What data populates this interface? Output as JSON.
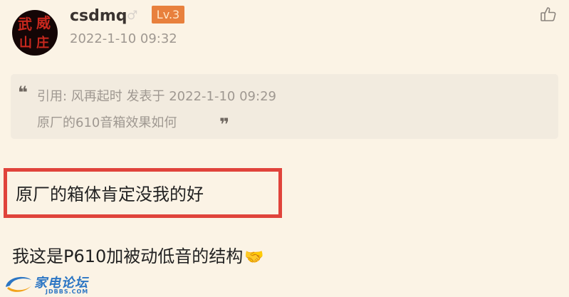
{
  "post": {
    "username": "csdmq",
    "gender_symbol": "♂",
    "level": "Lv.3",
    "timestamp": "2022-1-10 09:32"
  },
  "quote": {
    "meta": "引用: 风再起时 发表于 2022-1-10 09:29",
    "text": "原厂的610音箱效果如何"
  },
  "body": {
    "highlighted_text": "原厂的箱体肯定没我的好",
    "reply_text": "我这是P610加被动低音的结构",
    "emoji": "🤝"
  },
  "watermark": {
    "title": "家电论坛",
    "url": "JDBBS.COM"
  },
  "icons": {
    "like": "thumbs-up-icon",
    "quote_open": "quote-open-icon",
    "quote_close": "quote-close-icon"
  },
  "colors": {
    "background": "#fbf3e5",
    "level_badge": "#e8803d",
    "highlight_border": "#e0433b",
    "watermark": "#2c76c4"
  }
}
